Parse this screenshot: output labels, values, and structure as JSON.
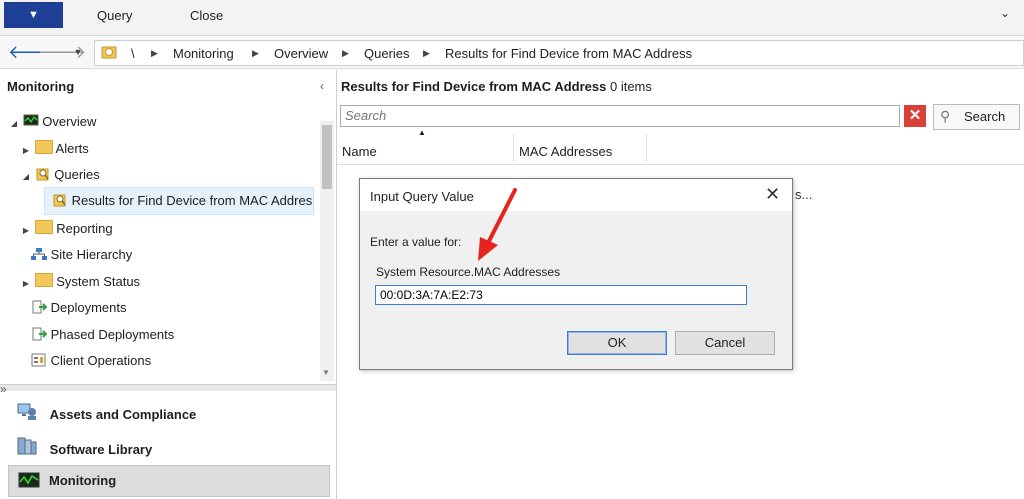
{
  "ribbon": {
    "tabs": [
      {
        "label": "Query"
      },
      {
        "label": "Close"
      }
    ]
  },
  "address_bar": {
    "root": "\\",
    "crumbs": [
      "Monitoring",
      "Overview",
      "Queries",
      "Results for Find Device from MAC Address"
    ]
  },
  "left_pane": {
    "title": "Monitoring",
    "tree": [
      {
        "label": "Overview",
        "icon": "monitor-icon",
        "level": 0,
        "expanded": true
      },
      {
        "label": "Alerts",
        "icon": "folder-icon",
        "level": 1,
        "expanded": false
      },
      {
        "label": "Queries",
        "icon": "query-icon",
        "level": 1,
        "expanded": true
      },
      {
        "label": "Results for Find Device from MAC Addres",
        "icon": "query-icon",
        "level": 2,
        "selected": true
      },
      {
        "label": "Reporting",
        "icon": "folder-icon",
        "level": 1,
        "expanded": false
      },
      {
        "label": "Site Hierarchy",
        "icon": "hierarchy-icon",
        "level": 1
      },
      {
        "label": "System Status",
        "icon": "folder-icon",
        "level": 1,
        "expanded": false
      },
      {
        "label": "Deployments",
        "icon": "deployment-icon",
        "level": 1
      },
      {
        "label": "Phased Deployments",
        "icon": "deployment-icon",
        "level": 1
      },
      {
        "label": "Client Operations",
        "icon": "client-ops-icon",
        "level": 1
      }
    ],
    "workspaces": [
      {
        "label": "Assets and Compliance",
        "icon": "assets-icon"
      },
      {
        "label": "Software Library",
        "icon": "library-icon"
      },
      {
        "label": "Monitoring",
        "icon": "monitoring-icon",
        "active": true
      }
    ]
  },
  "results": {
    "title": "Results for Find Device from MAC Address",
    "count": "0 items",
    "search_placeholder": "Search",
    "search_button": "Search",
    "columns": [
      "Name",
      "MAC Addresses"
    ],
    "behind_text": "s..."
  },
  "dialog": {
    "title": "Input Query Value",
    "prompt": "Enter a value for:",
    "field_label": "System Resource.MAC Addresses",
    "value": "00:0D:3A:7A:E2:73",
    "ok": "OK",
    "cancel": "Cancel"
  },
  "colors": {
    "file_tab": "#1f3f96",
    "selection": "#e5f1fb",
    "annotation_arrow": "#e8231e"
  }
}
